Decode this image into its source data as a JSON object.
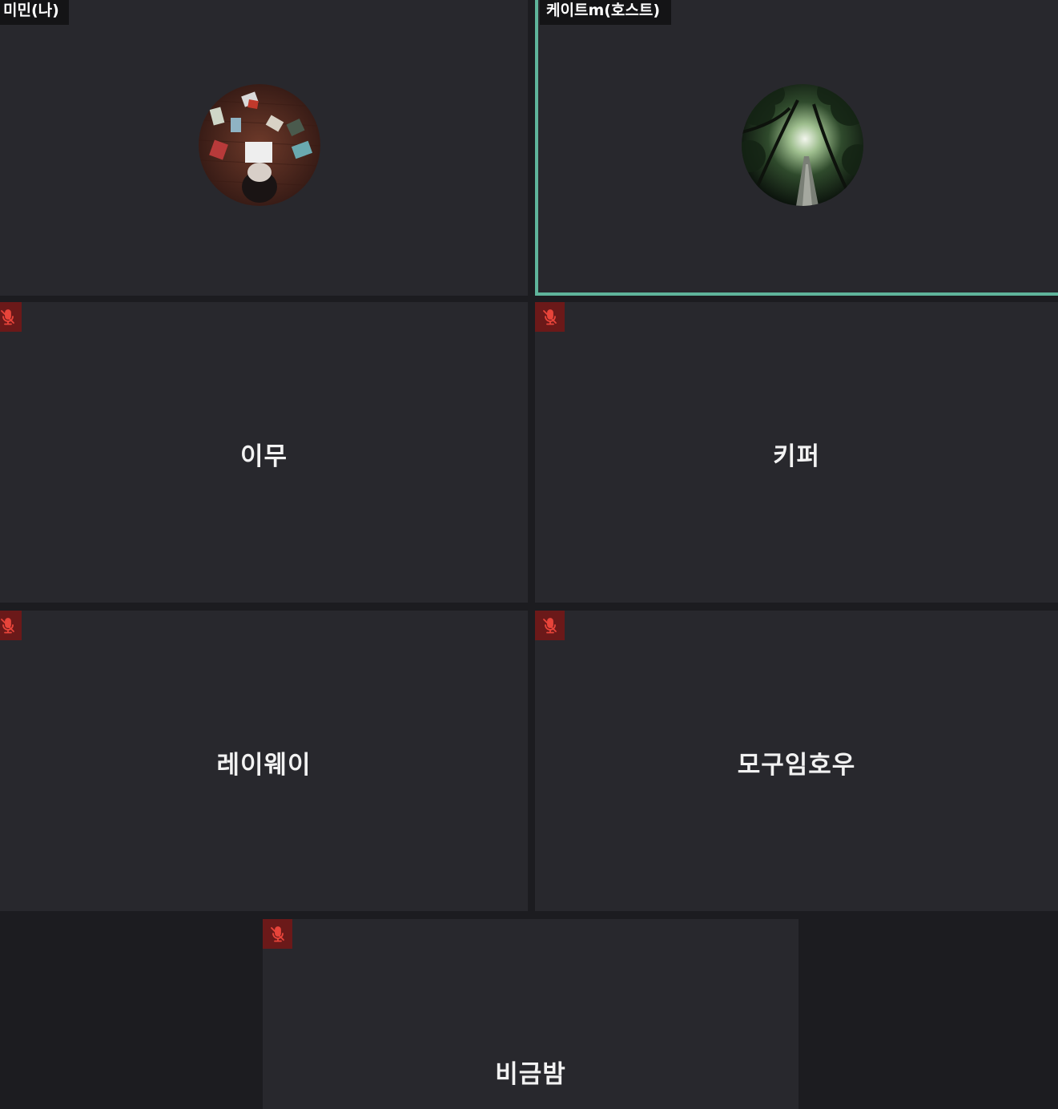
{
  "participants": [
    {
      "name": "미민(나)",
      "muted": false,
      "avatar": "books-reading-photo"
    },
    {
      "name": "케이트m(호스트)",
      "muted": false,
      "avatar": "forest-path-photo",
      "active_speaker": true
    },
    {
      "name": "이무",
      "muted": true
    },
    {
      "name": "키퍼",
      "muted": true
    },
    {
      "name": "레이웨이",
      "muted": true
    },
    {
      "name": "모구임호우",
      "muted": true
    },
    {
      "name": "비금밤",
      "muted": true
    }
  ],
  "icons": {
    "mute": "microphone-muted-icon"
  },
  "colors": {
    "active_speaker_border": "#5fb49b",
    "mute_badge": "#6b1919",
    "mute_icon": "#e8443a",
    "tile_background": "#28282d",
    "page_background": "#1c1c20"
  }
}
